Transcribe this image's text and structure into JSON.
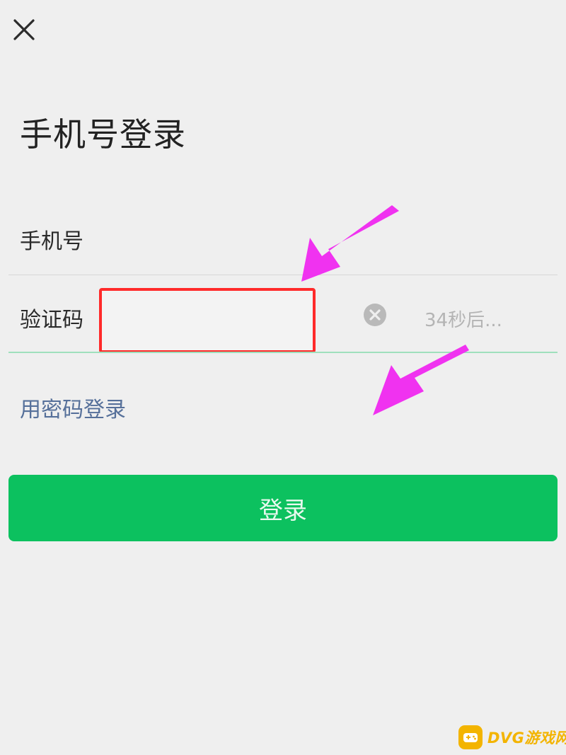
{
  "header": {
    "close_icon": "close-icon",
    "title": "手机号登录"
  },
  "form": {
    "phone_label": "手机号",
    "phone_value": "",
    "code_label": "验证码",
    "code_value": "",
    "clear_icon": "clear-circle-icon",
    "countdown_text": "34秒后..."
  },
  "links": {
    "password_login": "用密码登录"
  },
  "actions": {
    "login_label": "登录"
  },
  "annotations": {
    "highlight_color": "#ff2a2a",
    "arrow_color": "#f032f0"
  },
  "watermark": {
    "icon": "gamepad-icon",
    "text": "DVG游戏网"
  },
  "colors": {
    "background": "#efefef",
    "primary": "#0cc15f",
    "link": "#56709a",
    "active_underline": "#9fe0bd"
  }
}
